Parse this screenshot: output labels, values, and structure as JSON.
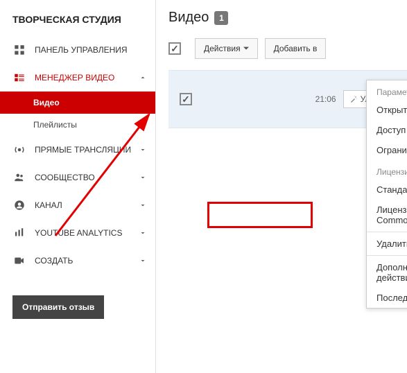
{
  "sidebar": {
    "title": "ТВОРЧЕСКАЯ СТУДИЯ",
    "items": [
      {
        "label": "ПАНЕЛЬ УПРАВЛЕНИЯ"
      },
      {
        "label": "МЕНЕДЖЕР ВИДЕО",
        "subitems": [
          {
            "label": "Видео"
          },
          {
            "label": "Плейлисты"
          }
        ]
      },
      {
        "label": "ПРЯМЫЕ ТРАНСЛЯЦИИ"
      },
      {
        "label": "СООБЩЕСТВО"
      },
      {
        "label": "КАНАЛ"
      },
      {
        "label": "YOUTUBE ANALYTICS"
      },
      {
        "label": "СОЗДАТЬ"
      }
    ],
    "feedback": "Отправить отзыв"
  },
  "main": {
    "title": "Видео",
    "count": "1",
    "toolbar": {
      "actions_label": "Действия",
      "addto_label": "Добавить в"
    },
    "row": {
      "time": "21:06",
      "enhance": "Улучши"
    }
  },
  "dropdown": {
    "section_access": "Параметры доступа",
    "items_access": [
      "Открытый доступ",
      "Доступ по ссылке",
      "Ограниченный доступ"
    ],
    "section_license": "Лицензия",
    "items_license": [
      "Стандартная лицензия",
      "Лицензия Creative Commons"
    ],
    "delete": "Удалить",
    "more": "Дополнительные действия...",
    "recent": "Последние действия..."
  }
}
